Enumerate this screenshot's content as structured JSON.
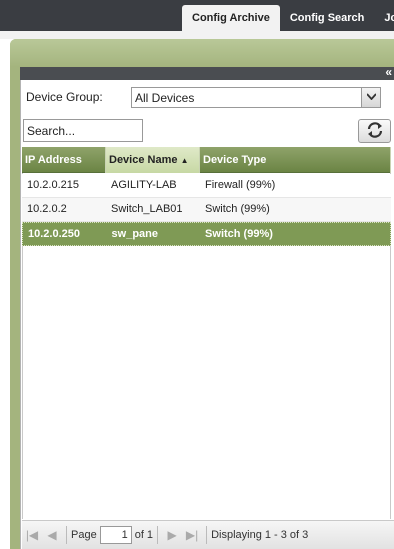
{
  "tabs": [
    {
      "label": "Config Archive",
      "active": true
    },
    {
      "label": "Config Search",
      "active": false
    },
    {
      "label": "Jo",
      "active": false
    }
  ],
  "filters": {
    "device_group_label": "Device Group:",
    "device_group_value": "All Devices",
    "search_placeholder": "Search..."
  },
  "grid": {
    "columns": [
      "IP Address",
      "Device Name",
      "Device Type"
    ],
    "sorted_column": "Device Name",
    "sort_direction": "ascending",
    "rows": [
      {
        "ip": "10.2.0.215",
        "name": "AGILITY-LAB",
        "type": "Firewall (99%)"
      },
      {
        "ip": "10.2.0.2",
        "name": "Switch_LAB01",
        "type": "Switch (99%)"
      },
      {
        "ip": "10.2.0.250",
        "name": "sw_pane",
        "type": "Switch (99%)",
        "selected": true
      }
    ]
  },
  "pager": {
    "page_label": "Page",
    "page_value": "1",
    "of_label": "of 1",
    "display_text": "Displaying 1 - 3 of 3"
  },
  "colors": {
    "accent_green": "#6b8444",
    "selected_row": "#7f9a55",
    "topbar": "#3a3d42"
  }
}
